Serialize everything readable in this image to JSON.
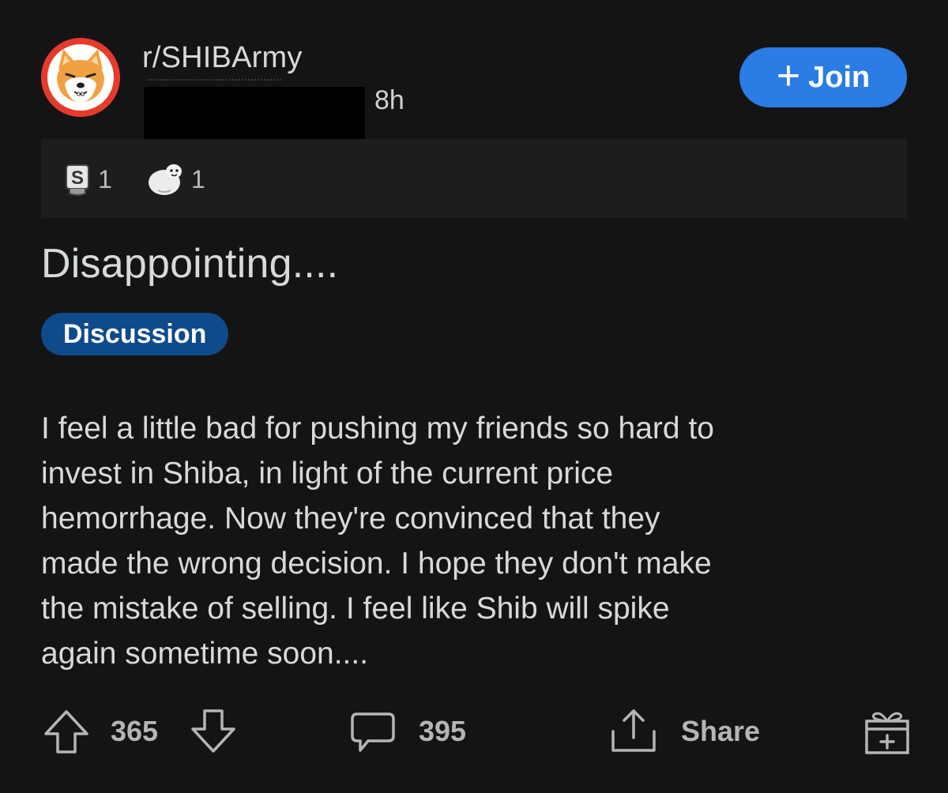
{
  "post": {
    "subreddit": "r/SHIBArmy",
    "age": "8h",
    "title": "Disappointing....",
    "flair": "Discussion",
    "body": [
      "I feel a little bad for pushing my friends so hard to",
      "invest in Shiba, in light of the current price",
      "hemorrhage.  Now they're convinced that they",
      "made the wrong decision.  I hope they don't make",
      "the mistake of selling.  I feel like Shib will spike",
      "again sometime soon...."
    ]
  },
  "header": {
    "join_label": "Join",
    "join_color": "#2c7ce5"
  },
  "awards": [
    {
      "icon": "silver-award-icon",
      "count": "1"
    },
    {
      "icon": "wholesome-seal-award-icon",
      "count": "1"
    }
  ],
  "actions": {
    "upvotes": "365",
    "comments": "395",
    "share_label": "Share"
  },
  "colors": {
    "background": "#141414",
    "flair_background": "#0f4a8a",
    "avatar_background": "#e53b2c"
  }
}
